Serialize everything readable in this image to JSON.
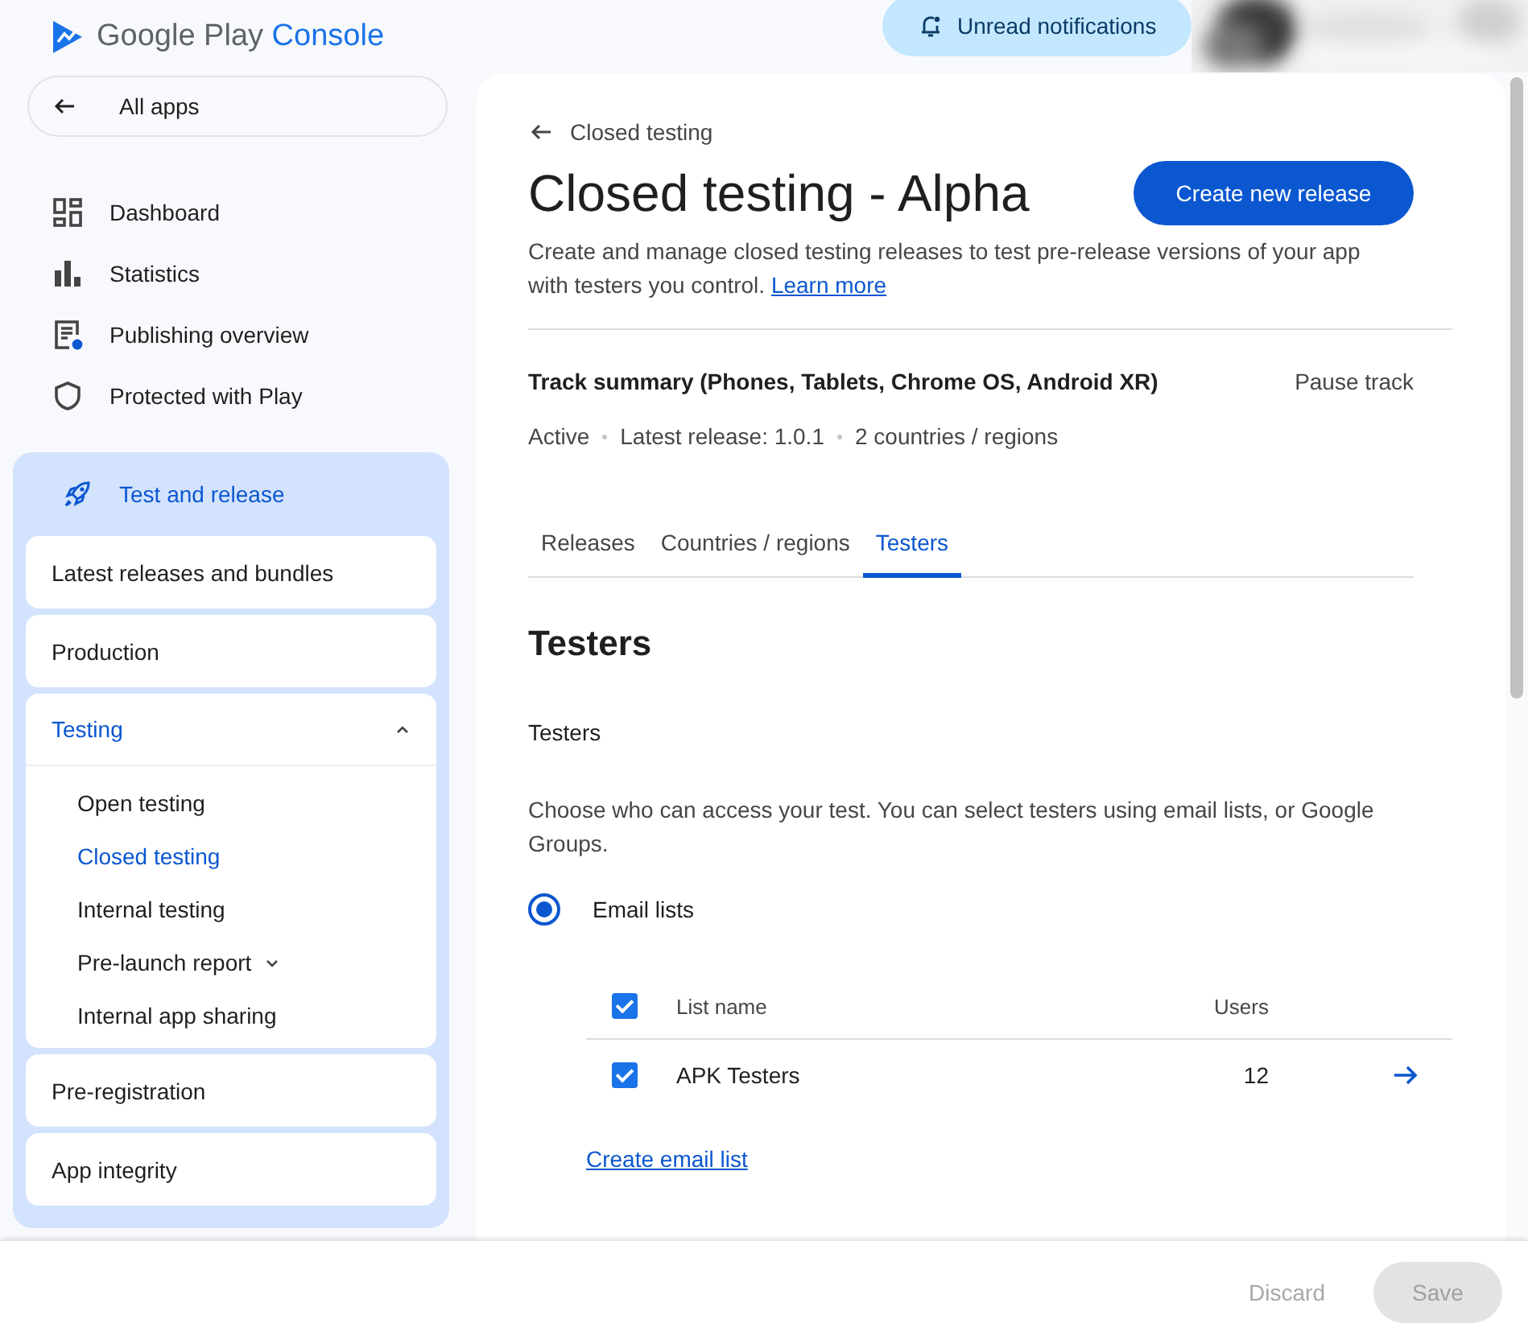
{
  "header": {
    "logo": {
      "brand": "Google Play",
      "product": "Console"
    },
    "notifications_button": "Unread notifications"
  },
  "sidebar": {
    "back_link": "All apps",
    "items": [
      {
        "label": "Dashboard",
        "kind": "dashboard"
      },
      {
        "label": "Statistics",
        "kind": "statistics"
      },
      {
        "label": "Publishing overview",
        "kind": "publishing"
      },
      {
        "label": "Protected with Play",
        "kind": "shield"
      }
    ],
    "section": {
      "label": "Test and release",
      "groups": [
        {
          "label": "Latest releases and bundles",
          "selected": false
        },
        {
          "label": "Production",
          "selected": false
        },
        {
          "label": "Testing",
          "selected": true,
          "expanded": true,
          "children": [
            {
              "label": "Open testing",
              "selected": false
            },
            {
              "label": "Closed testing",
              "selected": true
            },
            {
              "label": "Internal testing",
              "selected": false
            },
            {
              "label": "Pre-launch report",
              "selected": false,
              "expanded": false
            },
            {
              "label": "Internal app sharing",
              "selected": false
            }
          ]
        },
        {
          "label": "Pre-registration",
          "selected": false
        },
        {
          "label": "App integrity",
          "selected": false
        }
      ]
    }
  },
  "main": {
    "breadcrumb": "Closed testing",
    "title": "Closed testing - Alpha",
    "primary_button": "Create new release",
    "description": "Create and manage closed testing releases to test pre-release versions of your app with testers you control.",
    "learn_more": "Learn more",
    "track_summary": {
      "title": "Track summary (Phones, Tablets, Chrome OS, Android XR)",
      "action": "Pause track",
      "facts": [
        "Active",
        "Latest release: 1.0.1",
        "2 countries / regions"
      ]
    },
    "tabs": [
      {
        "label": "Releases",
        "selected": false
      },
      {
        "label": "Countries / regions",
        "selected": false
      },
      {
        "label": "Testers",
        "selected": true
      }
    ],
    "section_title": "Testers",
    "subheading": "Testers",
    "instructions": "Choose who can access your test. You can select testers using email lists, or Google Groups.",
    "radio": {
      "label": "Email lists",
      "selected": true
    },
    "table": {
      "all_checked": true,
      "columns": [
        "List name",
        "Users"
      ],
      "rows": [
        {
          "name": "APK Testers",
          "users": "12",
          "checked": true
        }
      ]
    },
    "create_link": "Create email list"
  },
  "footer": {
    "buttons": [
      {
        "label": "Discard",
        "kind": "text",
        "disabled": true
      },
      {
        "label": "Save",
        "kind": "filled",
        "disabled": true
      }
    ]
  }
}
